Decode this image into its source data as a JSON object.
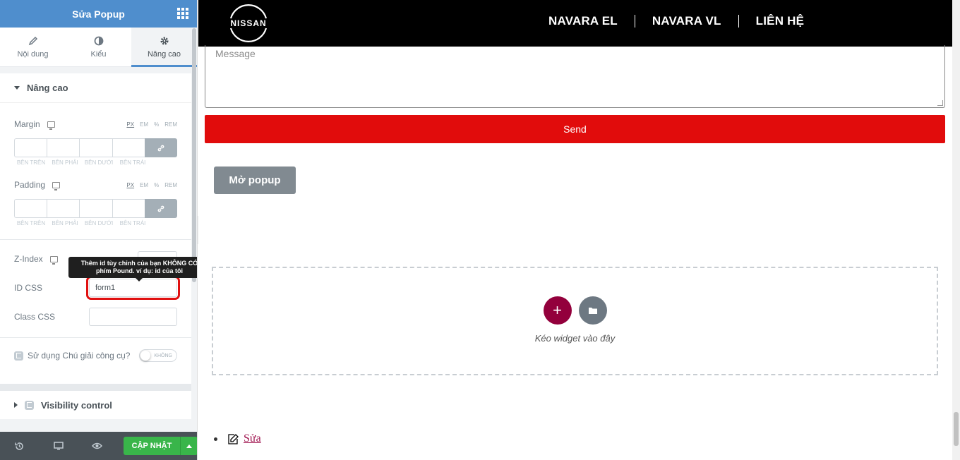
{
  "panel": {
    "title": "Sửa Popup",
    "tabs": [
      {
        "label": "Nội dung",
        "icon": "pencil-icon"
      },
      {
        "label": "Kiểu",
        "icon": "half-circle-icon"
      },
      {
        "label": "Nâng cao",
        "icon": "gear-icon",
        "active": true
      }
    ],
    "section_advanced": "Nâng cao",
    "margin": {
      "label": "Margin",
      "units": [
        "PX",
        "EM",
        "%",
        "REM"
      ],
      "selected_unit": "PX",
      "sides": [
        "BÊN TRÊN",
        "BÊN PHẢI",
        "BÊN DƯỚI",
        "BÊN TRÁI"
      ]
    },
    "padding": {
      "label": "Padding",
      "units": [
        "PX",
        "EM",
        "%",
        "REM"
      ],
      "selected_unit": "PX",
      "sides": [
        "BÊN TRÊN",
        "BÊN PHẢI",
        "BÊN DƯỚI",
        "BÊN TRÁI"
      ]
    },
    "zindex_label": "Z-Index",
    "tooltip": "Thêm id tùy chỉnh của bạn KHÔNG CÓ phím Pound. ví dụ: id của tôi",
    "css_id": {
      "label": "ID CSS",
      "value": "form1"
    },
    "css_class": {
      "label": "Class CSS",
      "value": ""
    },
    "tooltip_toggle": {
      "label": "Sử dụng Chú giải công cụ?",
      "state": "KHÔNG"
    },
    "visibility_section": "Visibility control",
    "footer": {
      "update_label": "CẬP NHẬT"
    }
  },
  "site": {
    "brand": "NISSAN",
    "nav": [
      "NAVARA EL",
      "NAVARA VL",
      "LIÊN HỆ"
    ],
    "message_placeholder": "Message",
    "send_label": "Send",
    "open_popup_label": "Mở popup",
    "dropzone_text": "Kéo widget vào đây",
    "edit_link": "Sửa"
  },
  "colors": {
    "panel_header": "#4f8ecd",
    "send": "#e10c0c",
    "update": "#39b54a",
    "add_widget": "#93003c"
  }
}
